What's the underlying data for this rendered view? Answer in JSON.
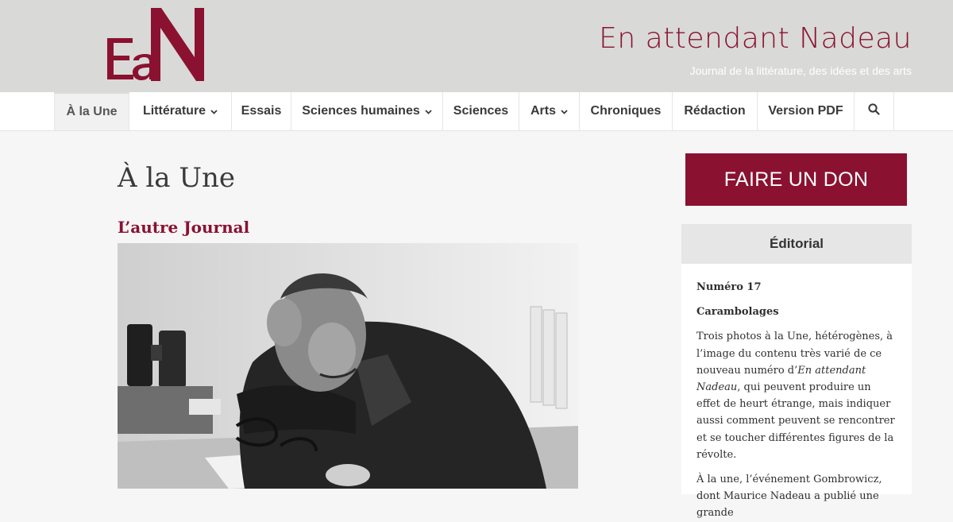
{
  "header": {
    "logo_text": "EaN",
    "site_title": "En attendant Nadeau",
    "tagline": "Journal de la littérature, des idées et des arts"
  },
  "nav": {
    "items": [
      {
        "label": "À la Une",
        "active": true,
        "dropdown": false
      },
      {
        "label": "Littérature",
        "active": false,
        "dropdown": true
      },
      {
        "label": "Essais",
        "active": false,
        "dropdown": false
      },
      {
        "label": "Sciences humaines",
        "active": false,
        "dropdown": true
      },
      {
        "label": "Sciences",
        "active": false,
        "dropdown": false
      },
      {
        "label": "Arts",
        "active": false,
        "dropdown": true
      },
      {
        "label": "Chroniques",
        "active": false,
        "dropdown": false
      },
      {
        "label": "Rédaction",
        "active": false,
        "dropdown": false
      },
      {
        "label": "Version PDF",
        "active": false,
        "dropdown": false
      }
    ],
    "search_icon": "search-icon",
    "dropdown_icon": "chevron-down-icon"
  },
  "main": {
    "page_title": "À la Une",
    "article_title": "L’autre Journal"
  },
  "sidebar": {
    "donate_label": "FAIRE UN DON",
    "editorial_title": "Éditorial",
    "issue": "Numéro 17",
    "heading": "Carambolages",
    "para1_part1": "Trois photos à la Une, hétérogènes, à l’image du contenu très varié de ce nouveau numéro d’",
    "para1_italic": "En attendant Nadeau",
    "para1_part2": ", qui peuvent produire un effet de heurt étrange, mais indiquer aussi comment peuvent se rencontrer et se toucher différentes figures de la révolte.",
    "para2": "À la une, l’événement Gombrowicz, dont Maurice Nadeau a publié une grande"
  },
  "colors": {
    "brand": "#8a1230",
    "header_bg": "#d9d9d7",
    "page_bg": "#f6f6f6"
  }
}
